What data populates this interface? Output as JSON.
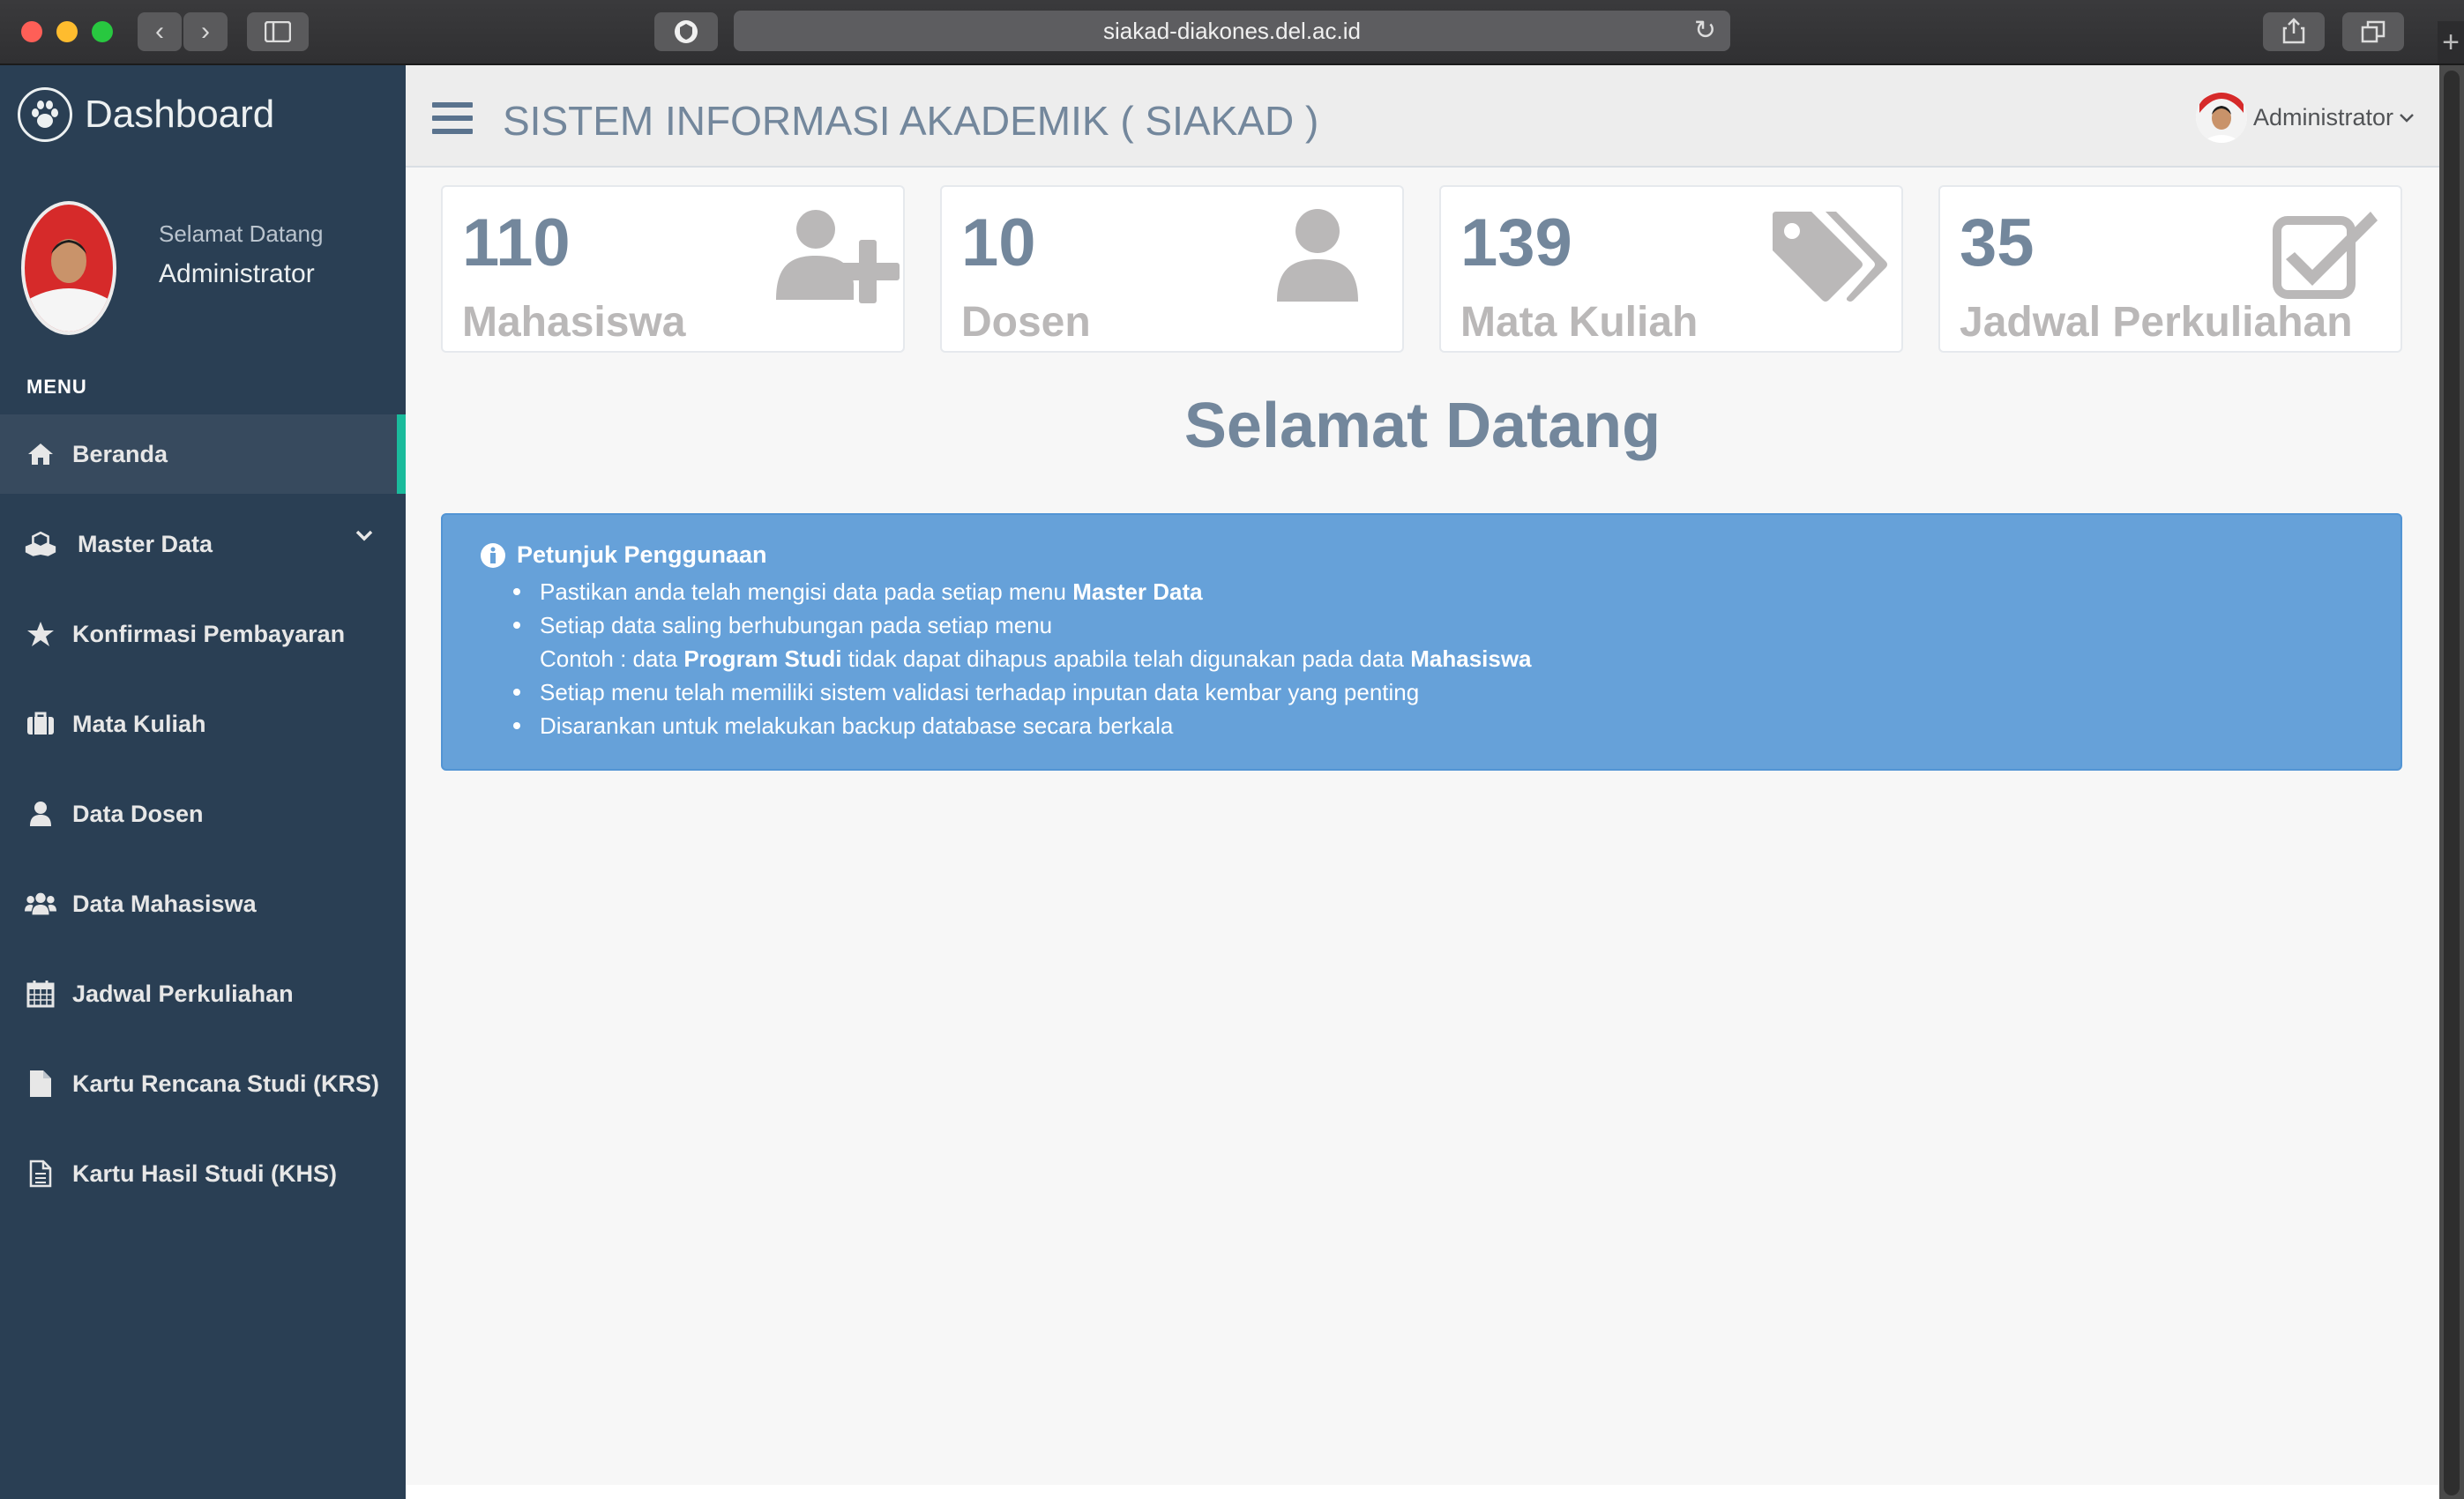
{
  "browser": {
    "url": "siakad-diakones.del.ac.id",
    "back_glyph": "‹",
    "forward_glyph": "›",
    "new_tab_glyph": "+"
  },
  "sidebar": {
    "brand_title": "Dashboard",
    "welcome_text": "Selamat Datang",
    "profile_name": "Administrator",
    "menu_heading": "MENU",
    "items": [
      {
        "label": "Beranda",
        "icon": "home-icon",
        "active": true
      },
      {
        "label": "Master Data",
        "icon": "cubes-icon",
        "has_submenu": true
      },
      {
        "label": "Konfirmasi Pembayaran",
        "icon": "star-icon"
      },
      {
        "label": "Mata Kuliah",
        "icon": "briefcase-icon"
      },
      {
        "label": "Data Dosen",
        "icon": "user-icon"
      },
      {
        "label": "Data Mahasiswa",
        "icon": "users-icon"
      },
      {
        "label": "Jadwal Perkuliahan",
        "icon": "calendar-icon"
      },
      {
        "label": "Kartu Rencana Studi (KRS)",
        "icon": "file-icon"
      },
      {
        "label": "Kartu Hasil Studi (KHS)",
        "icon": "file-text-icon"
      }
    ]
  },
  "header": {
    "title": "SISTEM INFORMASI AKADEMIK ( SIAKAD )",
    "user_name": "Administrator"
  },
  "stats": [
    {
      "count": "110",
      "label": "Mahasiswa",
      "icon": "user-plus-icon"
    },
    {
      "count": "10",
      "label": "Dosen",
      "icon": "user-icon"
    },
    {
      "count": "139",
      "label": "Mata Kuliah",
      "icon": "tags-icon"
    },
    {
      "count": "35",
      "label": "Jadwal Perkuliahan",
      "icon": "check-square-icon"
    }
  ],
  "main": {
    "heading": "Selamat Datang",
    "info": {
      "title": "Petunjuk Penggunaan",
      "line1_pre": "Pastikan anda telah mengisi data pada setiap menu ",
      "line1_bold": "Master Data",
      "line2": "Setiap data saling berhubungan pada setiap menu",
      "line3_pre": "Contoh : data ",
      "line3_bold1": "Program Studi",
      "line3_mid": " tidak dapat dihapus apabila telah digunakan pada data ",
      "line3_bold2": "Mahasiswa",
      "line4": "Setiap menu telah memiliki sistem validasi terhadap inputan data kembar yang penting",
      "line5": "Disarankan untuk melakukan backup database secara berkala"
    }
  },
  "colors": {
    "sidebar_bg": "#2a3f54",
    "accent": "#1abb9c",
    "info_bg": "#66a1d9",
    "title_text": "#73879c"
  }
}
